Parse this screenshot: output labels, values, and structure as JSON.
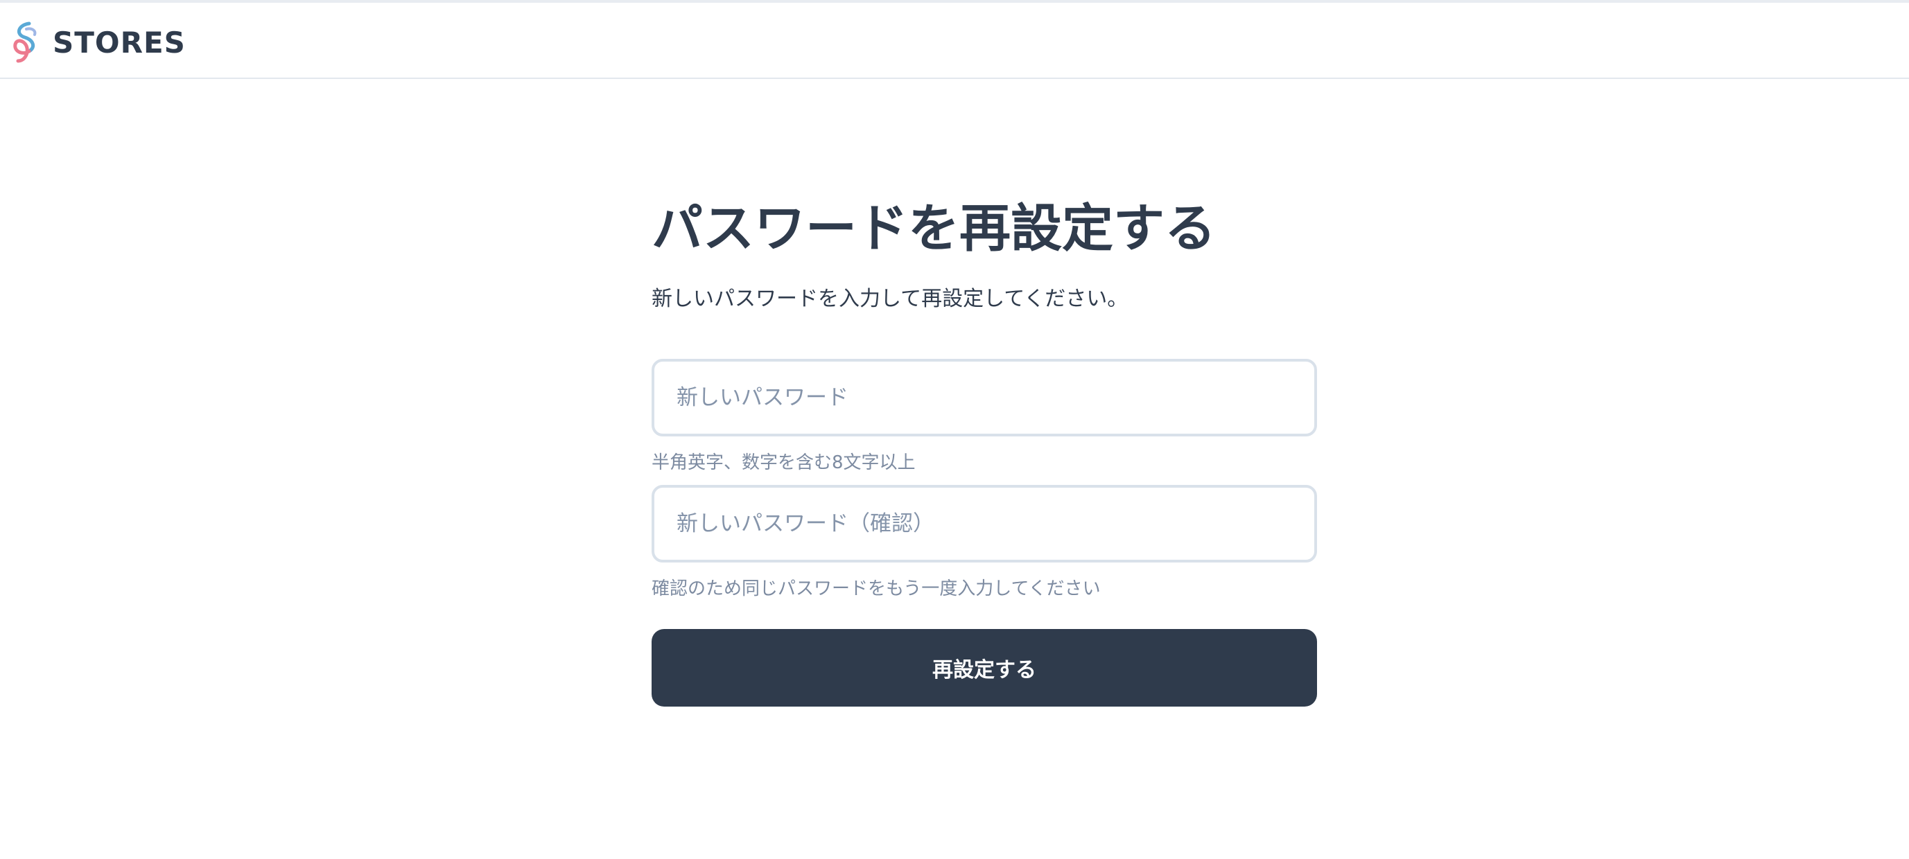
{
  "header": {
    "brand_name": "STORES",
    "logo_icon": "stores-logo-icon"
  },
  "form": {
    "title": "パスワードを再設定する",
    "description": "新しいパスワードを入力して再設定してください。",
    "new_password": {
      "placeholder": "新しいパスワード",
      "value": "",
      "hint": "半角英字、数字を含む8文字以上"
    },
    "confirm_password": {
      "placeholder": "新しいパスワード（確認）",
      "value": "",
      "hint": "確認のため同じパスワードをもう一度入力してください"
    },
    "submit_label": "再設定する"
  },
  "colors": {
    "text_primary": "#2f3b4c",
    "text_muted": "#7d8ba1",
    "button_bg": "#2f3b4c",
    "input_border": "#d9e1ea",
    "logo_blue": "#5aa9d6",
    "logo_pink": "#ec7a8e"
  }
}
